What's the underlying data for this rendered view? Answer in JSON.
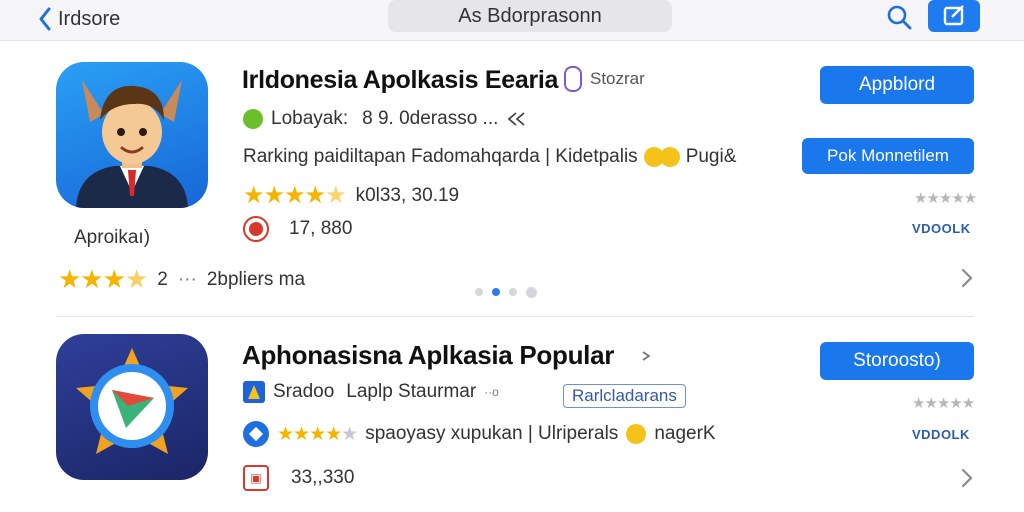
{
  "nav": {
    "back_label": "Irdsore",
    "search_text": "As Bdorprasonn"
  },
  "apps": [
    {
      "title": "Irldonesia Apolkasis Eearia",
      "title_tag": "Stozrar",
      "developer": "Lobayak:",
      "developer_extra": "8 9. 0derasso ...",
      "description": "Rarking paidiltapan Fadomahqarda | Kidetpalis",
      "description_extra": "Pugi&",
      "rating_text": "k0l33, 30.19",
      "downloads": "17, 880",
      "icon_caption": "Aproikaı)",
      "user_rating_label": "2 ... 2bpliers ma",
      "user_rating_count": "2",
      "user_rating_text": "2bpliers ma",
      "button_primary": "Appblord",
      "button_secondary": "Pok Monnetilem",
      "side_label": "VDOOLK",
      "stars_value": 4.5
    },
    {
      "title": "Aphonasisna Aplkasia Popular",
      "developer": "Sradoo",
      "developer_extra": "Laplp Staurmar",
      "developer_tag": "Rarlcladarans",
      "description": "spaoyasy xupukan | Ulriperals",
      "description_extra": "nagerK",
      "downloads": "33,,330",
      "button_primary": "Storoosto)",
      "side_label": "VDDOLK",
      "stars_value": 4
    }
  ],
  "pager": {
    "count": 4,
    "active": 1
  },
  "colors": {
    "accent": "#1a78ec",
    "star": "#f5b400"
  }
}
